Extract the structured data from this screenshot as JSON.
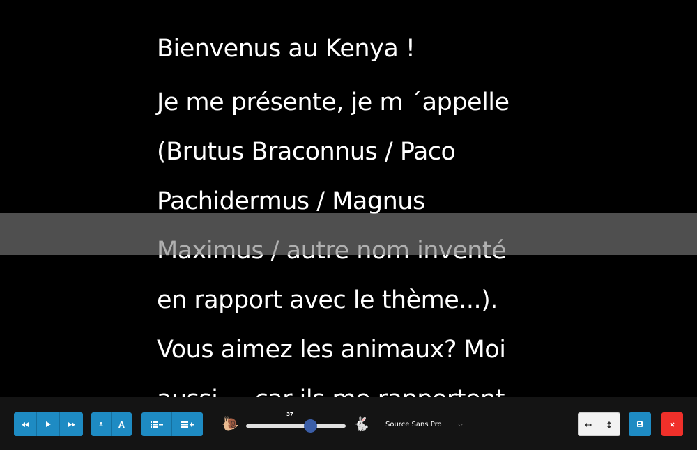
{
  "script": {
    "title": "Bienvenus au Kenya !",
    "lines": [
      "Je me présente, je m ´appelle",
      "(Brutus Braconnus / Paco",
      "Pachidermus / Magnus",
      "Maximus / autre nom inventé",
      "en rapport avec le thème...).",
      "Vous aimez les animaux? Moi",
      "aussi ... car ils me rapportent"
    ]
  },
  "toolbar": {
    "playback": [
      "rewind-icon",
      "play-icon",
      "fast-forward-icon"
    ],
    "text_size": {
      "smaller_label": "A",
      "larger_label": "A"
    },
    "line_spacing": [
      "decrease-line-spacing-icon",
      "increase-line-spacing-icon"
    ],
    "speed": {
      "value": "37",
      "fraction": 0.65,
      "slow_icon": "snail-icon",
      "fast_icon": "rabbit-icon"
    },
    "font": {
      "selected": "Source Sans Pro"
    },
    "orientation": [
      "horizontal-arrow-icon",
      "vertical-arrow-icon"
    ],
    "save_icon": "save-icon",
    "close_icon": "close-icon"
  },
  "colors": {
    "background": "#000000",
    "text": "#ffffff",
    "reading_guide": "#808080",
    "button_blue": "#1e8bc3",
    "button_red": "#f0302a",
    "slider_thumb": "#3b5ea8"
  }
}
